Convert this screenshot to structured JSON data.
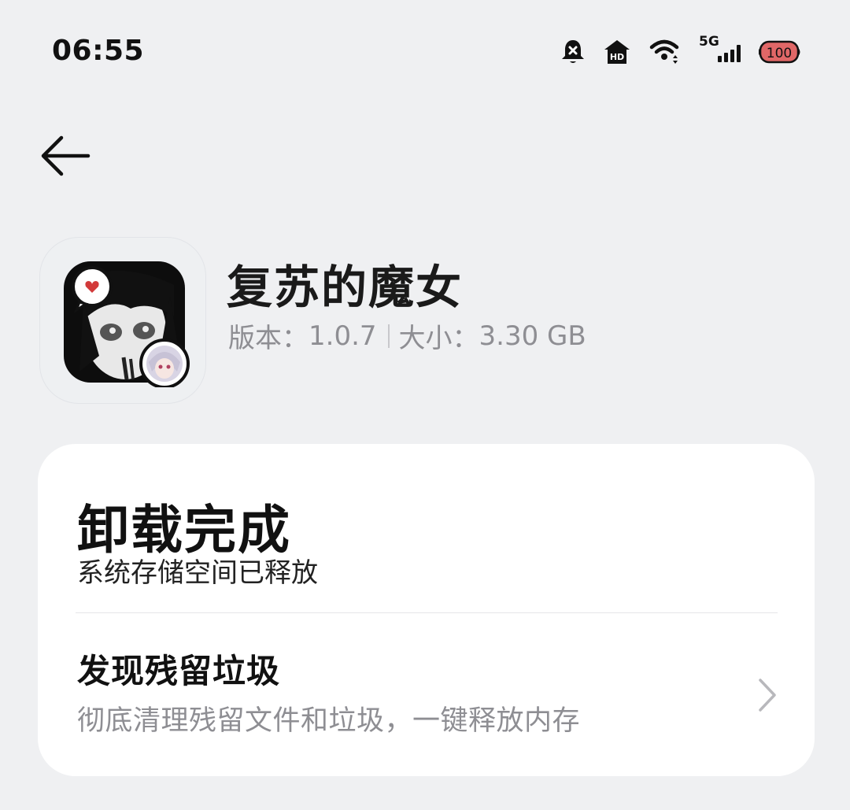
{
  "status_bar": {
    "time": "06:55",
    "network_label": "5G",
    "battery_level": "100",
    "icons": [
      "bell-muted-icon",
      "hd-icon",
      "wifi-icon",
      "signal-icon",
      "battery-icon"
    ]
  },
  "nav": {
    "back_icon": "back-arrow-icon"
  },
  "app": {
    "name": "复苏的魔女",
    "version_label": "版本：",
    "version": "1.0.7",
    "size_label": "大小：",
    "size": "3.30 GB"
  },
  "result_card": {
    "title": "卸载完成",
    "subtitle": "系统存储空间已释放",
    "residue": {
      "title": "发现残留垃圾",
      "description": "彻底清理残留文件和垃圾，一键释放内存"
    }
  },
  "colors": {
    "background": "#eff0f2",
    "card": "#ffffff",
    "secondary_text": "#8e8e93",
    "battery_accent": "#e06767"
  }
}
